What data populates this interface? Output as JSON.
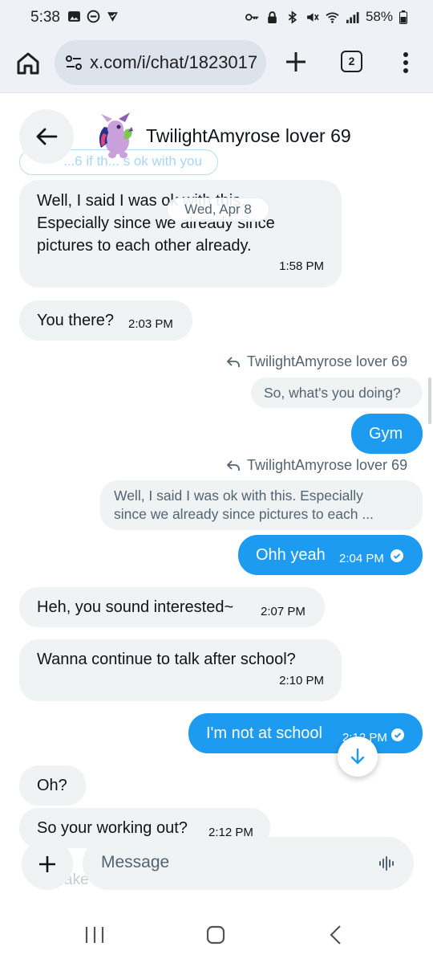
{
  "status_bar": {
    "time": "5:38",
    "battery": "58%"
  },
  "browser": {
    "url": "x.com/i/chat/1823017",
    "tab_count": "2"
  },
  "chat_header": {
    "title": "TwilightAmyrose lover 69",
    "faded_message_fragment": "...6 if th... s ok with you",
    "date_separator": "Wed, Apr 8"
  },
  "messages": [
    {
      "side": "in",
      "text_lines": [
        "Well, I said I was ok with this.",
        "Especially since we already since",
        "pictures to each other already."
      ],
      "time": "1:58 PM"
    },
    {
      "side": "in",
      "text": "You there?",
      "time": "2:03 PM"
    },
    {
      "side": "out",
      "reply_to": "TwilightAmyrose lover 69",
      "quote": "So, what's you doing?",
      "text": "Gym"
    },
    {
      "side": "out",
      "reply_to": "TwilightAmyrose lover 69",
      "quote_lines": [
        "Well, I said I was ok with this. Especially",
        "since we already since pictures to each ..."
      ],
      "text": "Ohh yeah",
      "time": "2:04 PM"
    },
    {
      "side": "in",
      "text": "Heh, you sound interested~",
      "time": "2:07 PM"
    },
    {
      "side": "in",
      "text": "Wanna continue to talk after school?",
      "time": "2:10 PM"
    },
    {
      "side": "out",
      "text": "I'm not at school",
      "time": "2:12 PM"
    },
    {
      "side": "in",
      "text": "Oh?"
    },
    {
      "side": "in",
      "text": "So your working out?",
      "time": "2:12 PM"
    }
  ],
  "composer": {
    "placeholder": "Message",
    "ghost_text": "ake"
  },
  "colors": {
    "accent": "#1d9bf0",
    "incoming_bubble": "#eff3f4",
    "secondary_text": "#536471"
  }
}
